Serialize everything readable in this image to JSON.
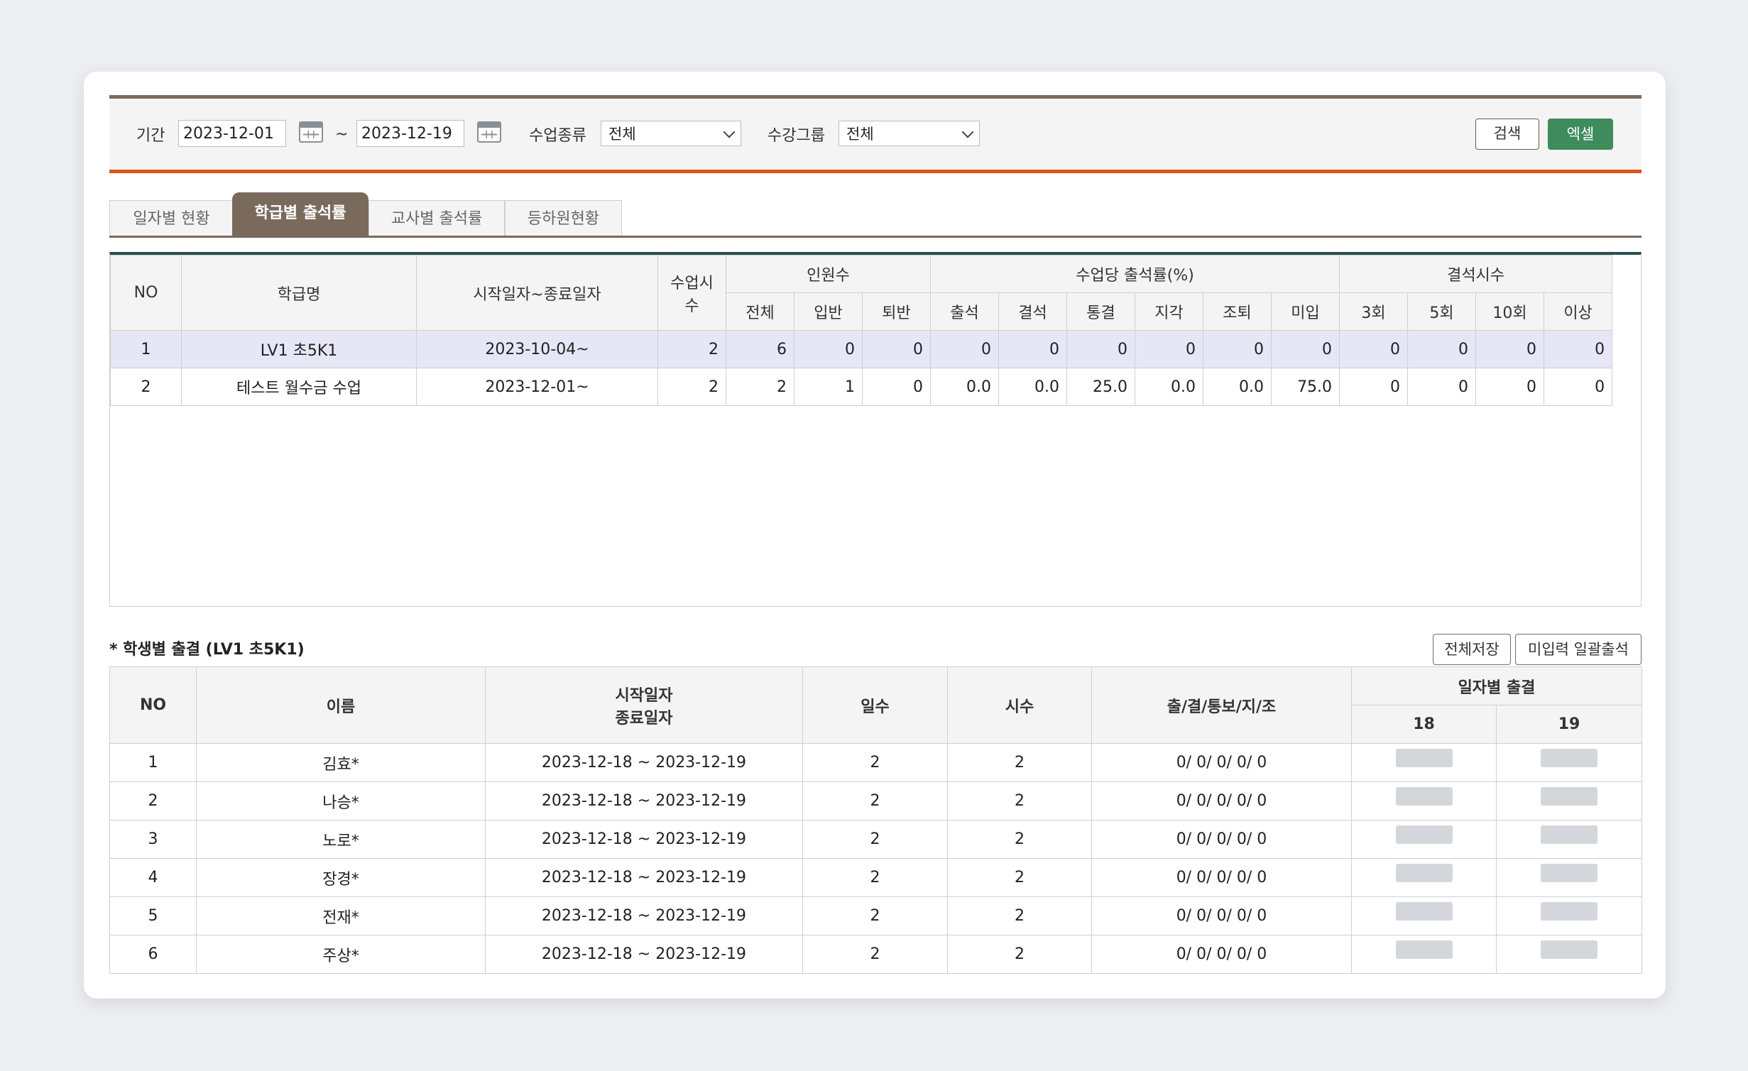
{
  "filter": {
    "period_label": "기간",
    "start_date": "2023-12-01",
    "tilde": "~",
    "end_date": "2023-12-19",
    "class_type_label": "수업종류",
    "class_type_value": "전체",
    "group_label": "수강그룹",
    "group_value": "전체",
    "search_button": "검색",
    "excel_button": "엑셀"
  },
  "tabs": [
    {
      "label": "일자별 현황"
    },
    {
      "label": "학급별 출석률"
    },
    {
      "label": "교사별 출석률"
    },
    {
      "label": "등하원현황"
    }
  ],
  "class_table": {
    "headers": {
      "no": "NO",
      "class_name": "학급명",
      "period": "시작일자~종료일자",
      "class_hours": "수업시수",
      "headcount": "인원수",
      "headcount_sub": [
        "전체",
        "입반",
        "퇴반"
      ],
      "rate": "수업당 출석률(%)",
      "rate_sub": [
        "출석",
        "결석",
        "통결",
        "지각",
        "조퇴",
        "미입"
      ],
      "absence": "결석시수",
      "absence_sub": [
        "3회",
        "5회",
        "10회",
        "이상"
      ]
    },
    "rows": [
      {
        "no": "1",
        "name": "LV1 초5K1",
        "period": "2023-10-04~",
        "hours": "2",
        "total": "6",
        "in": "0",
        "out": "0",
        "attend": "0",
        "absent": "0",
        "notified": "0",
        "late": "0",
        "early": "0",
        "unentered": "0",
        "a3": "0",
        "a5": "0",
        "a10": "0",
        "over": "0"
      },
      {
        "no": "2",
        "name": "테스트 월수금 수업",
        "period": "2023-12-01~",
        "hours": "2",
        "total": "2",
        "in": "1",
        "out": "0",
        "attend": "0.0",
        "absent": "0.0",
        "notified": "25.0",
        "late": "0.0",
        "early": "0.0",
        "unentered": "75.0",
        "a3": "0",
        "a5": "0",
        "a10": "0",
        "over": "0"
      }
    ]
  },
  "student_section": {
    "title": "* 학생별 출결 (LV1 초5K1)",
    "save_all_button": "전체저장",
    "bulk_attend_button": "미입력 일괄출석"
  },
  "student_table": {
    "headers": {
      "no": "NO",
      "name": "이름",
      "start_date": "시작일자",
      "end_date": "종료일자",
      "days": "일수",
      "hours": "시수",
      "stats": "출/결/통보/지/조",
      "daily": "일자별 출결",
      "day1": "18",
      "day2": "19"
    },
    "rows": [
      {
        "no": "1",
        "name": "김효*",
        "period": "2023-12-18 ~ 2023-12-19",
        "days": "2",
        "hours": "2",
        "stats": "0/ 0/ 0/ 0/ 0"
      },
      {
        "no": "2",
        "name": "나승*",
        "period": "2023-12-18 ~ 2023-12-19",
        "days": "2",
        "hours": "2",
        "stats": "0/ 0/ 0/ 0/ 0"
      },
      {
        "no": "3",
        "name": "노로*",
        "period": "2023-12-18 ~ 2023-12-19",
        "days": "2",
        "hours": "2",
        "stats": "0/ 0/ 0/ 0/ 0"
      },
      {
        "no": "4",
        "name": "장경*",
        "period": "2023-12-18 ~ 2023-12-19",
        "days": "2",
        "hours": "2",
        "stats": "0/ 0/ 0/ 0/ 0"
      },
      {
        "no": "5",
        "name": "전재*",
        "period": "2023-12-18 ~ 2023-12-19",
        "days": "2",
        "hours": "2",
        "stats": "0/ 0/ 0/ 0/ 0"
      },
      {
        "no": "6",
        "name": "주상*",
        "period": "2023-12-18 ~ 2023-12-19",
        "days": "2",
        "hours": "2",
        "stats": "0/ 0/ 0/ 0/ 0"
      }
    ]
  }
}
